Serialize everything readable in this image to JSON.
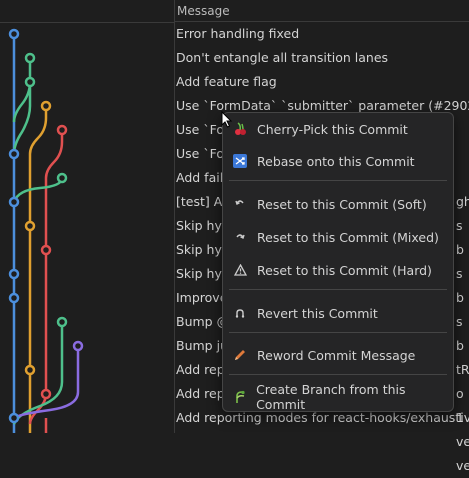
{
  "header": {
    "message_column": "Message"
  },
  "commits": [
    "Error handling fixed",
    "Don't entangle all transition lanes",
    "Add feature flag",
    "Use `FormData` `submitter` parameter (#29028)",
    "Use `Fo",
    "Use `Fo",
    "Add fail",
    "[test] Ac",
    "Skip hyd",
    "Skip hyd",
    "Skip hyd",
    "Improve",
    "Bump @",
    "Bump ju",
    "Add rep",
    "Add rep",
    "Add reporting modes for react-hooks/exhaustive-de"
  ],
  "behind_menu_fragments": [
    "ght",
    "s b",
    "s b",
    "s b",
    "tRe",
    "o 1",
    "ve-",
    "ve-"
  ],
  "context_menu": {
    "items": [
      {
        "label": "Cherry-Pick this Commit",
        "icon": "cherry-icon"
      },
      {
        "label": "Rebase onto this Commit",
        "icon": "rebase-icon"
      },
      {
        "label": "Reset to this Commit (Soft)",
        "icon": "reset-soft-icon"
      },
      {
        "label": "Reset to this Commit (Mixed)",
        "icon": "reset-mixed-icon"
      },
      {
        "label": "Reset to this Commit (Hard)",
        "icon": "warning-icon"
      },
      {
        "label": "Revert this Commit",
        "icon": "revert-icon"
      },
      {
        "label": "Reword Commit Message",
        "icon": "pencil-icon"
      },
      {
        "label": "Create Branch from this Commit",
        "icon": "branch-icon"
      }
    ]
  },
  "colors": {
    "lane_blue": "#4c8fdc",
    "lane_green": "#4ec08b",
    "lane_orange": "#e0a030",
    "lane_red": "#e05050",
    "lane_purple": "#8a6ce0"
  }
}
